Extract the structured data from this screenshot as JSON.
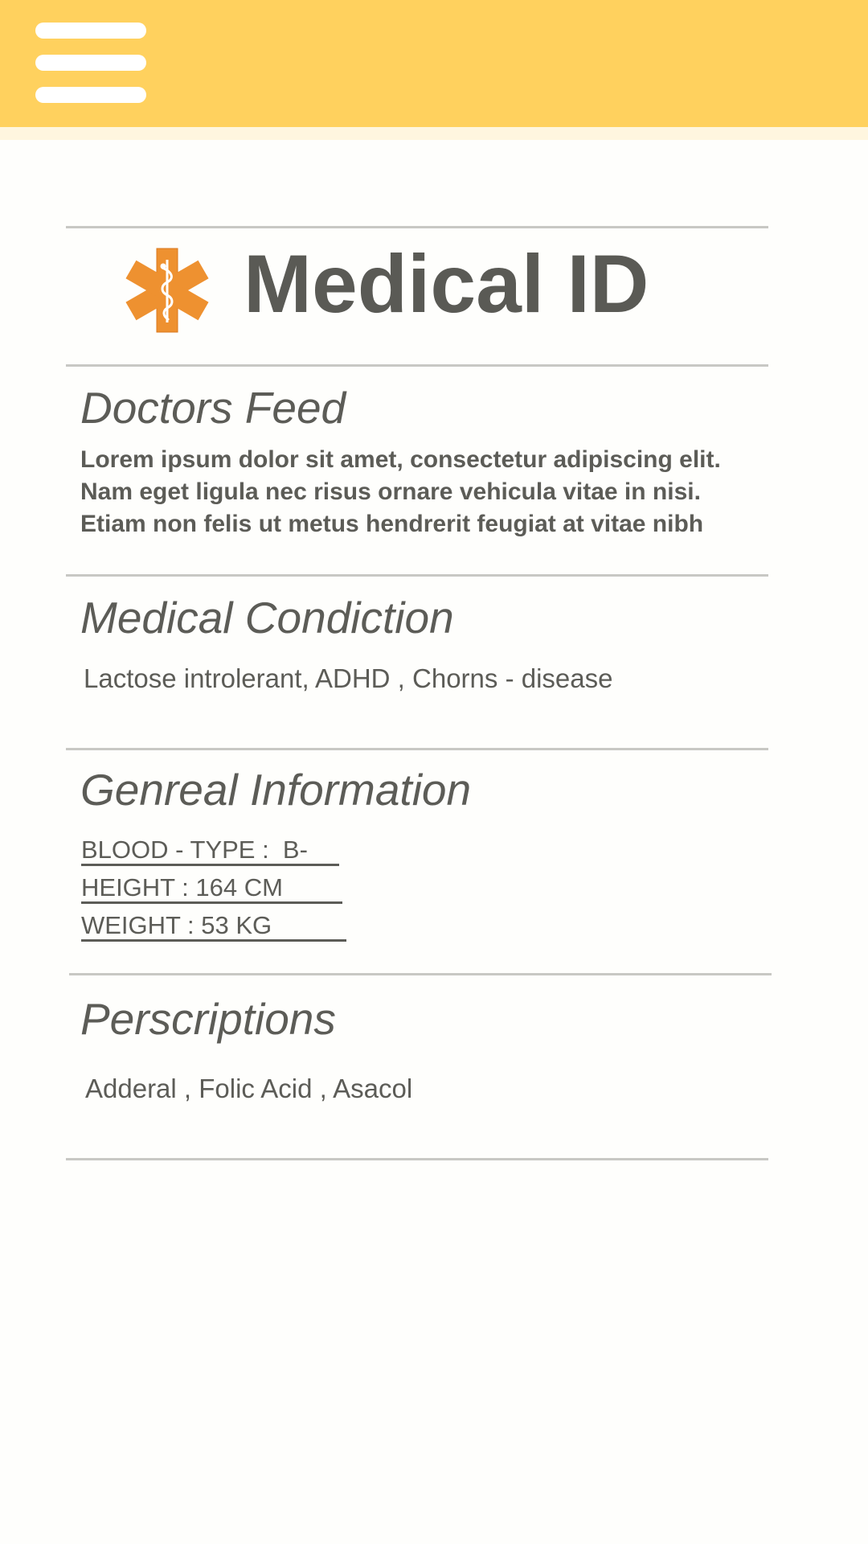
{
  "header": {
    "menu_icon": "hamburger-menu-icon",
    "background_color": "#ffd15e"
  },
  "title": {
    "icon": "star-of-life-icon",
    "icon_color": "#ee9130",
    "text": "Medical ID"
  },
  "doctors_feed": {
    "heading": "Doctors Feed",
    "lines": [
      "Lorem ipsum dolor sit amet, consectetur adipiscing elit.",
      "Nam eget ligula nec risus ornare vehicula vitae in nisi.",
      "Etiam non felis ut metus hendrerit feugiat at vitae nibh"
    ]
  },
  "medical_condition": {
    "heading": "Medical Condiction",
    "text": "Lactose introlerant, ADHD , Chorns - disease"
  },
  "general_information": {
    "heading": "Genreal Information",
    "blood_type": "BLOOD - TYPE :  B-",
    "height": "HEIGHT : 164 CM",
    "weight": "WEIGHT : 53 KG"
  },
  "prescriptions": {
    "heading": "Perscriptions",
    "text": "Adderal , Folic Acid , Asacol"
  }
}
